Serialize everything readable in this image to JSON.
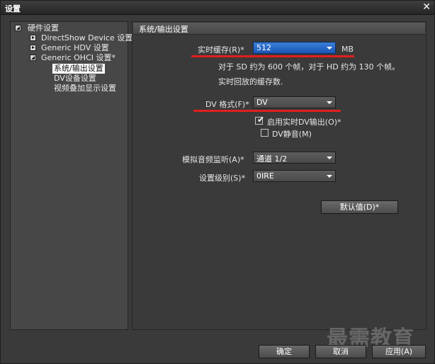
{
  "window": {
    "title": "设置",
    "close_glyph": "✕"
  },
  "tree": {
    "root": "硬件设置",
    "items": [
      {
        "label": "DirectShow Device 设置"
      },
      {
        "label": "Generic HDV 设置"
      },
      {
        "label": "Generic OHCI 设置*"
      },
      {
        "label": "系统/输出设置"
      },
      {
        "label": "DV设备设置"
      },
      {
        "label": "视频叠加显示设置"
      }
    ]
  },
  "panel": {
    "title": "系统/输出设置",
    "cache": {
      "label": "实时缓存(R)*",
      "value": "512",
      "unit": "MB"
    },
    "note1": "对于 SD 约为 600 个帧，对于 HD 约为 130 个帧。",
    "note2": "实时回放的缓存数.",
    "dv_format": {
      "label": "DV 格式(F)*",
      "value": "DV"
    },
    "enable_dv_output": {
      "label": "启用实时DV输出(O)*",
      "checked": true
    },
    "dv_mute": {
      "label": "DV静音(M)",
      "checked": false
    },
    "audio_monitor": {
      "label": "模拟音频监听(A)*",
      "value": "通道 1/2"
    },
    "setup_level": {
      "label": "设置级别(S)*",
      "value": "0IRE"
    },
    "default_button": "默认值(D)*"
  },
  "buttons": {
    "ok": "确定",
    "cancel": "取消",
    "apply": "应用(A)"
  },
  "watermark": "最需教育",
  "colors": {
    "highlight_red": "#e21e1e",
    "active_combo": "#1a56b8"
  }
}
